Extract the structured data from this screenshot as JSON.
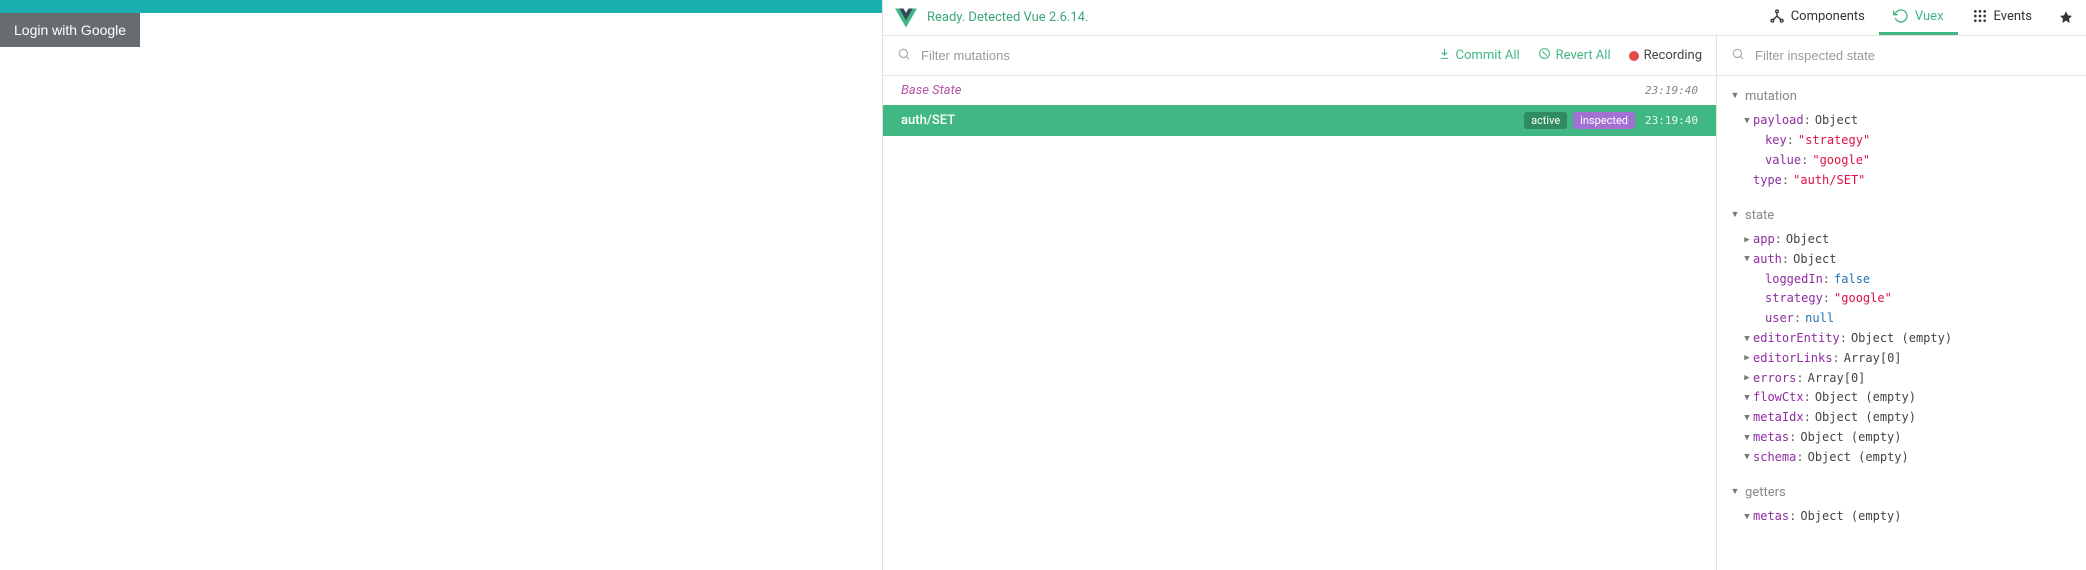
{
  "app": {
    "login_button": "Login with Google"
  },
  "devtools": {
    "status": "Ready. Detected Vue 2.6.14.",
    "tabs": {
      "components": "Components",
      "vuex": "Vuex",
      "events": "Events"
    },
    "toolbar": {
      "filter_placeholder": "Filter mutations",
      "commit_all": "Commit All",
      "revert_all": "Revert All",
      "recording": "Recording",
      "filter_state_placeholder": "Filter inspected state"
    },
    "mutations": {
      "base": {
        "label": "Base State",
        "time": "23:19:40"
      },
      "items": [
        {
          "name": "auth/SET",
          "time": "23:19:40",
          "active": "active",
          "inspected": "inspected"
        }
      ]
    },
    "state_panel": {
      "mutation": {
        "title": "mutation",
        "payload_label": "payload",
        "payload_type": "Object",
        "payload": {
          "key_label": "key",
          "key_value": "\"strategy\"",
          "value_label": "value",
          "value_value": "\"google\""
        },
        "type_label": "type",
        "type_value": "\"auth/SET\""
      },
      "state": {
        "title": "state",
        "app": {
          "label": "app",
          "type": "Object"
        },
        "auth": {
          "label": "auth",
          "type": "Object",
          "loggedIn": {
            "label": "loggedIn",
            "value": "false"
          },
          "strategy": {
            "label": "strategy",
            "value": "\"google\""
          },
          "user": {
            "label": "user",
            "value": "null"
          }
        },
        "editorEntity": {
          "label": "editorEntity",
          "type": "Object (empty)"
        },
        "editorLinks": {
          "label": "editorLinks",
          "type": "Array[0]"
        },
        "errors": {
          "label": "errors",
          "type": "Array[0]"
        },
        "flowCtx": {
          "label": "flowCtx",
          "type": "Object (empty)"
        },
        "metaIdx": {
          "label": "metaIdx",
          "type": "Object (empty)"
        },
        "metas": {
          "label": "metas",
          "type": "Object (empty)"
        },
        "schema": {
          "label": "schema",
          "type": "Object (empty)"
        }
      },
      "getters": {
        "title": "getters",
        "metas": {
          "label": "metas",
          "type": "Object (empty)"
        }
      }
    }
  }
}
